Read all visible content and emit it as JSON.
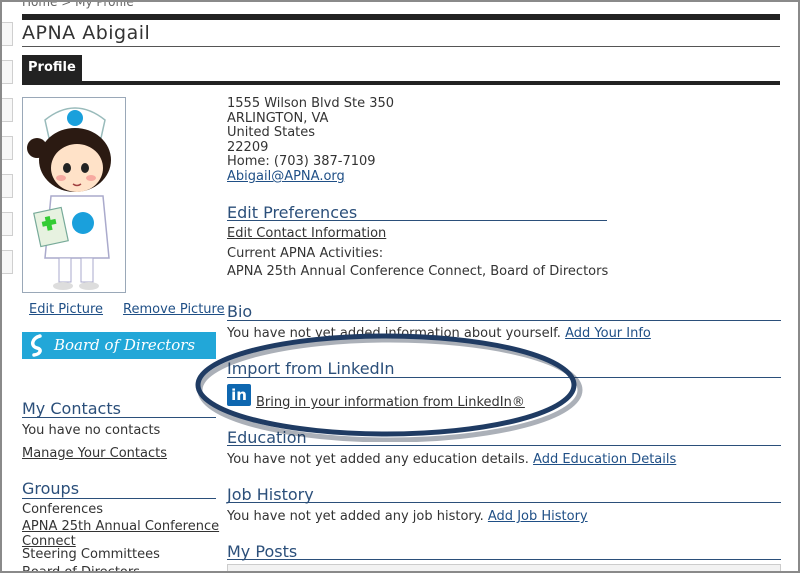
{
  "breadcrumb": "Home > My Profile",
  "profile": {
    "name": "APNA Abigail",
    "tab": "Profile",
    "edit_picture": "Edit Picture",
    "remove_picture": "Remove Picture",
    "badge": "Board of Directors"
  },
  "address": {
    "street": "1555 Wilson Blvd Ste 350",
    "city": "ARLINGTON, VA",
    "country": "United States",
    "zip": "22209",
    "phone": "Home: (703) 387-7109",
    "email": "Abigail@APNA.org"
  },
  "preferences": {
    "heading": "Edit Preferences",
    "edit_contact": "Edit Contact Information",
    "activities_label": "Current APNA Activities:",
    "activities": "APNA 25th Annual Conference Connect, Board of Directors"
  },
  "bio": {
    "heading": "Bio",
    "text": "You have not yet added information about yourself.",
    "action": "Add Your Info"
  },
  "linkedin": {
    "heading": "Import from LinkedIn",
    "logo": "in",
    "action": "Bring in your information from LinkedIn®"
  },
  "education": {
    "heading": "Education",
    "text": "You have not yet added any education details.",
    "action": "Add Education Details"
  },
  "job_history": {
    "heading": "Job History",
    "text": "You have not yet added any job history.",
    "action": "Add Job History"
  },
  "posts": {
    "heading": "My Posts"
  },
  "contacts": {
    "heading": "My Contacts",
    "text": "You have no contacts",
    "action": "Manage Your Contacts"
  },
  "groups": {
    "heading": "Groups",
    "cat1": "Conferences",
    "group1_line1": "APNA 25th Annual Conference",
    "group1_line2": "Connect",
    "cat2": "Steering Committees",
    "group2": "Board of Directors"
  },
  "colors": {
    "accent": "#2b4f7a",
    "badge": "#22a7d8",
    "linkedin": "#0e67b0",
    "highlight_ellipse": "#1f3b63"
  }
}
